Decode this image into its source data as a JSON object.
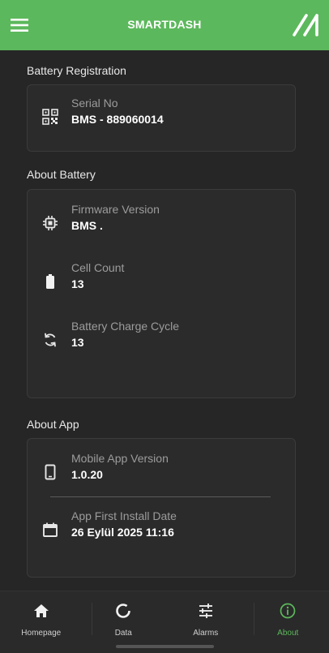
{
  "header": {
    "title": "SMARTDASH",
    "menu_icon": "hamburger-menu-icon",
    "logo_icon": "double-slash-logo-icon"
  },
  "battery_registration": {
    "title": "Battery Registration",
    "serial": {
      "icon": "qr-code-icon",
      "label": "Serial No",
      "value": "BMS - 889060014"
    }
  },
  "about_battery": {
    "title": "About Battery",
    "items": [
      {
        "icon": "chip-icon",
        "label": "Firmware Version",
        "value": "BMS ."
      },
      {
        "icon": "battery-icon",
        "label": "Cell Count",
        "value": "13"
      },
      {
        "icon": "cycle-icon",
        "label": "Battery Charge Cycle",
        "value": "13"
      }
    ]
  },
  "about_app": {
    "title": "About App",
    "items": [
      {
        "icon": "phone-icon",
        "label": "Mobile App Version",
        "value": "1.0.20"
      },
      {
        "icon": "calendar-icon",
        "label": "App First Install Date",
        "value": "26 Eylül 2025 11:16"
      }
    ]
  },
  "bottom_nav": {
    "items": [
      {
        "label": "Homepage",
        "icon": "home-icon"
      },
      {
        "label": "Data",
        "icon": "data-ring-icon"
      },
      {
        "label": "Alarms",
        "icon": "sliders-icon"
      },
      {
        "label": "About",
        "icon": "info-icon",
        "active": true
      }
    ]
  },
  "colors": {
    "accent": "#5cb85c",
    "background": "#262626",
    "card": "#2b2b2b"
  }
}
